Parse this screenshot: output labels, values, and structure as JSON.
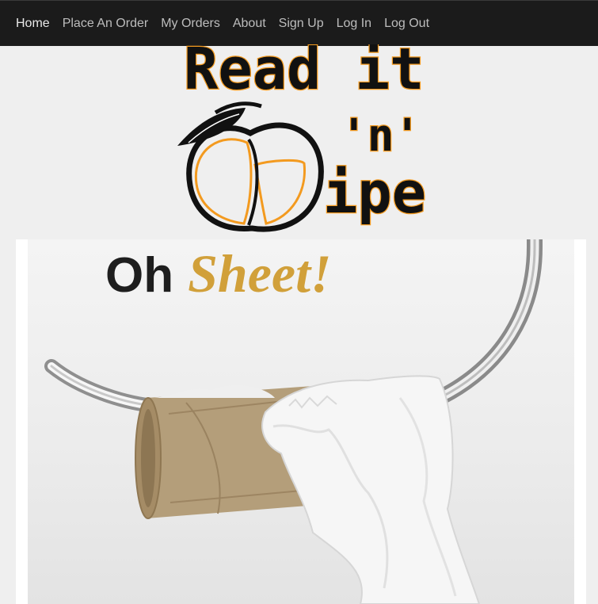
{
  "nav": {
    "items": [
      {
        "label": "Home",
        "name": "nav-home"
      },
      {
        "label": "Place An Order",
        "name": "nav-place-order"
      },
      {
        "label": "My Orders",
        "name": "nav-my-orders"
      },
      {
        "label": "About",
        "name": "nav-about"
      },
      {
        "label": "Sign Up",
        "name": "nav-sign-up"
      },
      {
        "label": "Log In",
        "name": "nav-log-in"
      },
      {
        "label": "Log Out",
        "name": "nav-log-out"
      }
    ]
  },
  "logo": {
    "line1": "Read it",
    "line2": "'n'",
    "line3": "ipe",
    "icon": "peach-icon",
    "colors": {
      "outline": "#111111",
      "accent": "#f39a1f"
    }
  },
  "hero": {
    "title_part1": "Oh",
    "title_part2": "Sheet!",
    "image": "toilet-paper-roll-image",
    "colors": {
      "title_dark": "#1e1e1e",
      "title_gold": "#d1a03a"
    }
  }
}
